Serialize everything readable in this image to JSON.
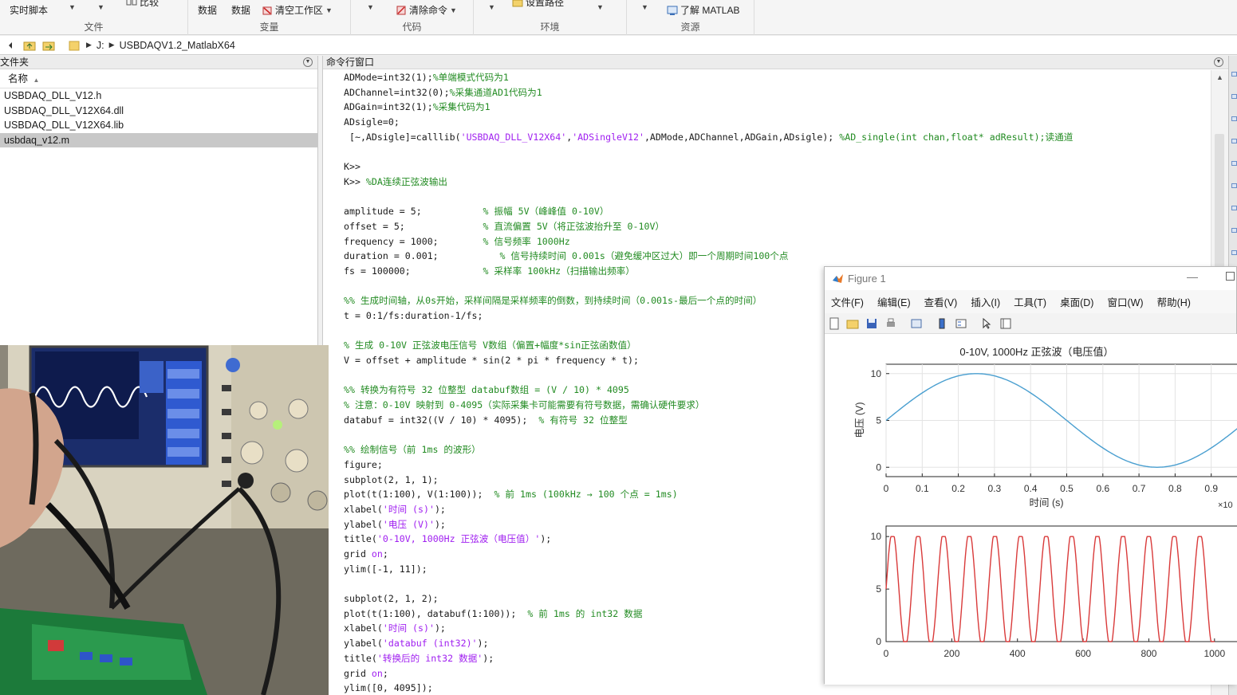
{
  "toolstrip": {
    "items": [
      {
        "label": "实时脚本",
        "x": 12,
        "w": 54
      },
      {
        "label": "比较",
        "x": 177,
        "w": 30
      },
      {
        "label": "数据",
        "x": 248,
        "w": 26
      },
      {
        "label": "数据",
        "x": 290,
        "w": 26
      },
      {
        "label": "清空工作区",
        "x": 348,
        "w": 62
      },
      {
        "label": "清除命令",
        "x": 516,
        "w": 52
      },
      {
        "label": "设置路径",
        "x": 662,
        "w": 52
      },
      {
        "label": "了解 MATLAB",
        "x": 856,
        "w": 82
      }
    ],
    "groups": [
      "文件",
      "变量",
      "代码",
      "环境",
      "资源"
    ]
  },
  "address": {
    "crumbs": [
      "J:",
      "USBDAQV1.2_MatlabX64"
    ]
  },
  "folder": {
    "title": "文件夹",
    "col_name": "名称",
    "sort_icon": "▲",
    "files": [
      {
        "name": "USBDAQ_DLL_V12.h",
        "selected": false
      },
      {
        "name": "USBDAQ_DLL_V12X64.dll",
        "selected": false
      },
      {
        "name": "USBDAQ_DLL_V12X64.lib",
        "selected": false
      },
      {
        "name": "usbdaq_v12.m",
        "selected": true
      }
    ]
  },
  "command_window": {
    "title": "命令行窗口",
    "lines": [
      {
        "t": "ADMode=int32(1);",
        "c": "%单端模式代码为1"
      },
      {
        "t": "ADChannel=int32(0);",
        "c": "%采集通道AD1代码为1"
      },
      {
        "t": "ADGain=int32(1);",
        "c": "%采集代码为1"
      },
      {
        "t": "ADsigle=0;"
      },
      {
        "t": " [~,ADsigle]=calllib(",
        "s": "'USBDAQ_DLL_V12X64'",
        "t2": ",",
        "s2": "'ADSingleV12'",
        "t3": ",ADMode,ADChannel,ADGain,ADsigle); ",
        "c": "%AD_single(int chan,float* adResult);读通道"
      },
      {
        "t": ""
      },
      {
        "t": "K>>"
      },
      {
        "t": "K>> ",
        "c": "%DA连续正弦波输出"
      },
      {
        "t": ""
      },
      {
        "t": "amplitude = 5;           ",
        "c": "% 振幅 5V（峰峰值 0-10V）"
      },
      {
        "t": "offset = 5;              ",
        "c": "% 直流偏置 5V（将正弦波抬升至 0-10V）"
      },
      {
        "t": "frequency = 1000;        ",
        "c": "% 信号频率 1000Hz"
      },
      {
        "t": "duration = 0.001;           ",
        "c": "% 信号持续时间 0.001s（避免缓冲区过大）即一个周期时间100个点"
      },
      {
        "t": "fs = 100000;             ",
        "c": "% 采样率 100kHz（扫描输出频率）"
      },
      {
        "t": ""
      },
      {
        "t": "",
        "c": "%% 生成时间轴，从0s开始，采样间隔是采样频率的倒数，到持续时间（0.001s-最后一个点的时间）"
      },
      {
        "t": "t = 0:1/fs:duration-1/fs;"
      },
      {
        "t": ""
      },
      {
        "t": "",
        "c": "% 生成 0-10V 正弦波电压信号 V数组（偏置+幅度*sin正弦函数值）"
      },
      {
        "t": "V = offset + amplitude * sin(2 * pi * frequency * t);"
      },
      {
        "t": ""
      },
      {
        "t": "",
        "c": "%% 转换为有符号 32 位整型 databuf数组 = (V / 10) * 4095"
      },
      {
        "t": "",
        "c": "% 注意：0-10V 映射到 0-4095（实际采集卡可能需要有符号数据，需确认硬件要求）"
      },
      {
        "t": "databuf = int32((V / 10) * 4095);  ",
        "c": "% 有符号 32 位整型"
      },
      {
        "t": ""
      },
      {
        "t": "",
        "c": "%% 绘制信号（前 1ms 的波形）"
      },
      {
        "t": "figure;"
      },
      {
        "t": "subplot(2, 1, 1);"
      },
      {
        "t": "plot(t(1:100), V(1:100));  ",
        "c": "% 前 1ms (100kHz → 100 个点 = 1ms)"
      },
      {
        "t": "xlabel(",
        "s": "'时间 (s)'",
        "t2": ");"
      },
      {
        "t": "ylabel(",
        "s": "'电压 (V)'",
        "t2": ");"
      },
      {
        "t": "title(",
        "s": "'0-10V, 1000Hz 正弦波（电压值）'",
        "t2": ");"
      },
      {
        "t": "grid ",
        "s": "on",
        "t2": ";"
      },
      {
        "t": "ylim([-1, 11]);"
      },
      {
        "t": ""
      },
      {
        "t": "subplot(2, 1, 2);"
      },
      {
        "t": "plot(t(1:100), databuf(1:100));  ",
        "c": "% 前 1ms 的 int32 数据"
      },
      {
        "t": "xlabel(",
        "s": "'时间 (s)'",
        "t2": ");"
      },
      {
        "t": "ylabel(",
        "s": "'databuf (int32)'",
        "t2": ");"
      },
      {
        "t": "title(",
        "s": "'转换后的 int32 数据'",
        "t2": ");"
      },
      {
        "t": "grid ",
        "s": "on",
        "t2": ";"
      },
      {
        "t": "ylim([0, 4095]);"
      }
    ]
  },
  "figure": {
    "title": "Figure 1",
    "minimize": "—",
    "menus": [
      "文件(F)",
      "编辑(E)",
      "查看(V)",
      "插入(I)",
      "工具(T)",
      "桌面(D)",
      "窗口(W)",
      "帮助(H)"
    ]
  },
  "chart_data": [
    {
      "type": "line",
      "title": "0-10V, 1000Hz 正弦波（电压值）",
      "xlabel": "时间 (s)",
      "ylabel": "电压 (V)",
      "exponent_label": "×10",
      "xticks": [
        "0",
        "0.1",
        "0.2",
        "0.3",
        "0.4",
        "0.5",
        "0.6",
        "0.7",
        "0.8",
        "0.9"
      ],
      "yticks": [
        "0",
        "5",
        "10"
      ],
      "xlim": [
        0,
        1.0
      ],
      "ylim": [
        -1,
        11
      ],
      "grid": true,
      "color": "#4a9fd0",
      "series": [
        {
          "function": "5 + 5*sin(2*pi*x)",
          "x_start": 0,
          "x_end": 1.0
        }
      ]
    },
    {
      "type": "line",
      "title": "",
      "xticks": [
        "0",
        "200",
        "400",
        "600",
        "800",
        "1000"
      ],
      "yticks": [
        "0",
        "5",
        "10"
      ],
      "xlim": [
        0,
        1100
      ],
      "ylim": [
        0,
        11
      ],
      "grid": false,
      "color": "#d93a3a",
      "series": [
        {
          "function": "clipped sinusoid, period 78",
          "x_start": 0,
          "x_end": 1000,
          "clip": 10
        }
      ]
    }
  ]
}
